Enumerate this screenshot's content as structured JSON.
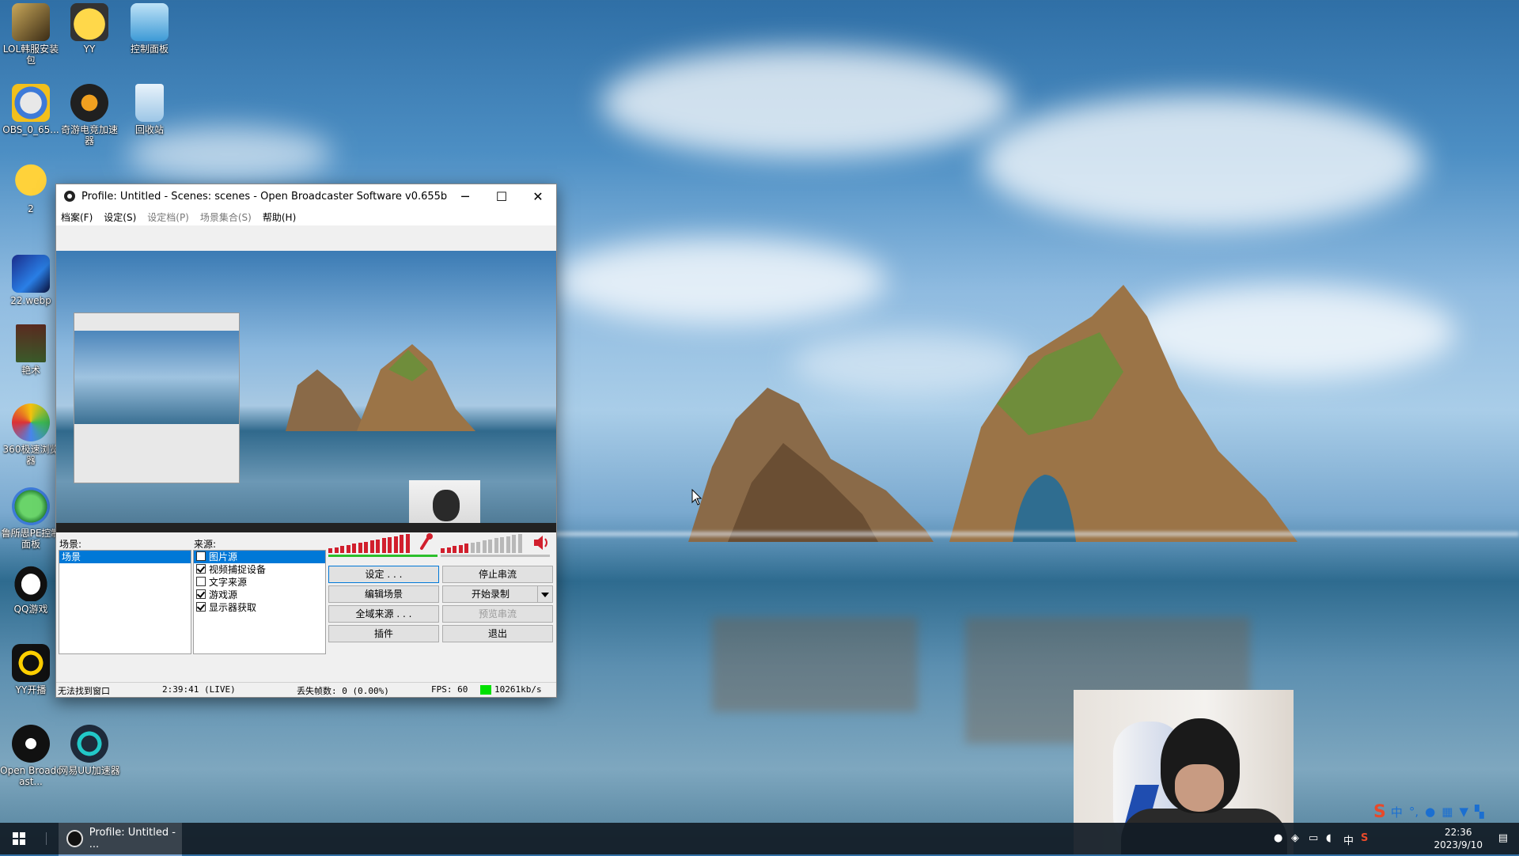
{
  "desktop": {
    "icons": [
      {
        "label": "LOL韩服安装包"
      },
      {
        "label": "YY"
      },
      {
        "label": "控制面板"
      },
      {
        "label": "OBS_0_65..."
      },
      {
        "label": "奇游电竞加速器"
      },
      {
        "label": "回收站"
      },
      {
        "label": "2"
      },
      {
        "label": "22.webp"
      },
      {
        "label": "艳术"
      },
      {
        "label": "360极速浏览器"
      },
      {
        "label": "鲁所思PE控制面板"
      },
      {
        "label": "QQ游戏"
      },
      {
        "label": "YY开播"
      },
      {
        "label": "Open Broadcast..."
      },
      {
        "label": "网易UU加速器"
      }
    ]
  },
  "obs": {
    "title": "Profile: Untitled - Scenes: scenes - Open Broadcaster Software v0.655b",
    "window_buttons": {
      "minimize": "─",
      "maximize": "☐",
      "close": "✕"
    },
    "menu": [
      {
        "label": "档案(F)",
        "enabled": true
      },
      {
        "label": "设定(S)",
        "enabled": true
      },
      {
        "label": "设定档(P)",
        "enabled": false
      },
      {
        "label": "场景集合(S)",
        "enabled": false
      },
      {
        "label": "帮助(H)",
        "enabled": true
      }
    ],
    "scenes_label": "场景:",
    "scenes": [
      {
        "label": "场景",
        "selected": true
      }
    ],
    "sources_label": "来源:",
    "sources": [
      {
        "label": "图片源",
        "checked": false,
        "selected": true
      },
      {
        "label": "视频捕捉设备",
        "checked": true,
        "selected": false
      },
      {
        "label": "文字来源",
        "checked": false,
        "selected": false
      },
      {
        "label": "游戏源",
        "checked": true,
        "selected": false
      },
      {
        "label": "显示器获取",
        "checked": true,
        "selected": false
      }
    ],
    "buttons": {
      "settings": "设定 . . .",
      "stop_stream": "停止串流",
      "edit_scene": "编辑场景",
      "start_record": "开始录制",
      "global_sources": "全域来源 . . .",
      "preview_stream": "预览串流",
      "plugins": "插件",
      "exit": "退出"
    },
    "status": {
      "message": "无法找到窗口",
      "time": "2:39:41 (LIVE)",
      "dropped_frames": "丢失帧数: 0 (0.00%)",
      "fps": "FPS: 60",
      "bitrate": "10261kb/s"
    }
  },
  "taskbar": {
    "active_item": "Profile: Untitled - ...",
    "ime_lang": "中",
    "tray_lang": "中",
    "time": "22:36",
    "date": "2023/9/10"
  },
  "colors": {
    "selection": "#0078d7",
    "meter_red": "#d11f2d",
    "meter_grey": "#b8b8b8",
    "bitrate_green": "#00e000"
  }
}
